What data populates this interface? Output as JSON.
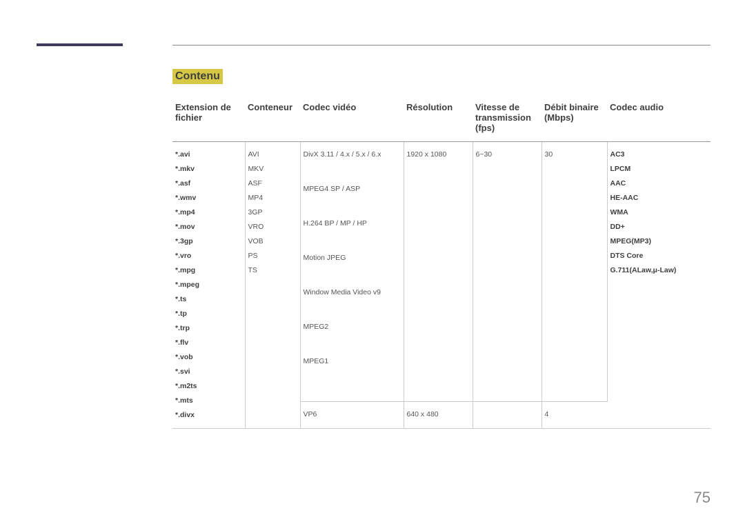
{
  "section_title": "Contenu",
  "page_number": "75",
  "headers": {
    "ext": "Extension de fichier",
    "container": "Conteneur",
    "vcodec": "Codec vidéo",
    "resolution": "Résolution",
    "framerate": "Vitesse de transmission (fps)",
    "bitrate": "Débit binaire (Mbps)",
    "acodec": "Codec audio"
  },
  "extensions": [
    "*.avi",
    "*.mkv",
    "*.asf",
    "*.wmv",
    "*.mp4",
    "*.mov",
    "*.3gp",
    "*.vro",
    "*.mpg",
    "*.mpeg",
    "*.ts",
    "*.tp",
    "*.trp",
    "*.flv",
    "*.vob",
    "*.svi",
    "*.m2ts",
    "*.mts",
    "*.divx"
  ],
  "containers": [
    "AVI",
    "MKV",
    "ASF",
    "MP4",
    "3GP",
    "VRO",
    "VOB",
    "PS",
    "TS"
  ],
  "audio_codecs": [
    "AC3",
    "LPCM",
    "AAC",
    "HE-AAC",
    "WMA",
    "DD+",
    "MPEG(MP3)",
    "DTS Core",
    "G.711(ALaw,μ-Law)"
  ],
  "row1": {
    "vcodecs": [
      "DivX 3.11 / 4.x / 5.x / 6.x",
      "MPEG4 SP / ASP",
      "H.264 BP / MP / HP",
      "Motion JPEG",
      "Window Media Video v9",
      "MPEG2",
      "MPEG1"
    ],
    "resolution": "1920 x 1080",
    "framerate": "6~30",
    "bitrate": "30"
  },
  "row2": {
    "vcodec": "VP6",
    "resolution": "640 x 480",
    "framerate": "",
    "bitrate": "4"
  }
}
